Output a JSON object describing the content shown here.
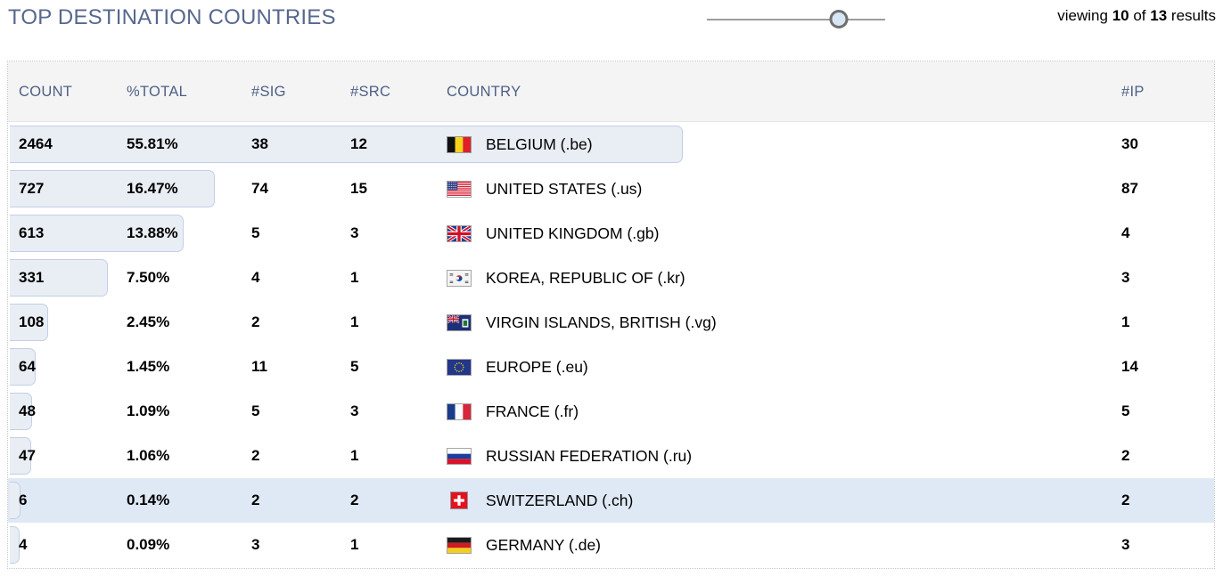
{
  "header": {
    "title": "TOP DESTINATION COUNTRIES",
    "slider": {
      "name": "results-count-slider",
      "position_pct": 74
    },
    "viewing": {
      "prefix": "viewing",
      "shown": "10",
      "middle": "of",
      "total": "13",
      "suffix": "results"
    }
  },
  "table": {
    "columns": [
      {
        "key": "count",
        "label": "COUNT"
      },
      {
        "key": "total",
        "label": "%TOTAL"
      },
      {
        "key": "sig",
        "label": "#SIG"
      },
      {
        "key": "src",
        "label": "#SRC"
      },
      {
        "key": "country",
        "label": "COUNTRY"
      },
      {
        "key": "ip",
        "label": "#IP"
      }
    ],
    "rows": [
      {
        "count": "2464",
        "total": "55.81%",
        "sig": "38",
        "src": "12",
        "country": "BELGIUM (.be)",
        "ip": "30",
        "flag": "flag-be",
        "bar_pct": 55.81,
        "highlight": false
      },
      {
        "count": "727",
        "total": "16.47%",
        "sig": "74",
        "src": "15",
        "country": "UNITED STATES (.us)",
        "ip": "87",
        "flag": "flag-us",
        "bar_pct": 16.47,
        "highlight": false
      },
      {
        "count": "613",
        "total": "13.88%",
        "sig": "5",
        "src": "3",
        "country": "UNITED KINGDOM (.gb)",
        "ip": "4",
        "flag": "flag-gb",
        "bar_pct": 13.88,
        "highlight": false
      },
      {
        "count": "331",
        "total": "7.50%",
        "sig": "4",
        "src": "1",
        "country": "KOREA, REPUBLIC OF (.kr)",
        "ip": "3",
        "flag": "flag-kr",
        "bar_pct": 7.5,
        "highlight": false
      },
      {
        "count": "108",
        "total": "2.45%",
        "sig": "2",
        "src": "1",
        "country": "VIRGIN ISLANDS, BRITISH (.vg)",
        "ip": "1",
        "flag": "flag-vg",
        "bar_pct": 2.45,
        "highlight": false
      },
      {
        "count": "64",
        "total": "1.45%",
        "sig": "11",
        "src": "5",
        "country": "EUROPE (.eu)",
        "ip": "14",
        "flag": "flag-eu",
        "bar_pct": 1.45,
        "highlight": false
      },
      {
        "count": "48",
        "total": "1.09%",
        "sig": "5",
        "src": "3",
        "country": "FRANCE (.fr)",
        "ip": "5",
        "flag": "flag-fr",
        "bar_pct": 1.09,
        "highlight": false
      },
      {
        "count": "47",
        "total": "1.06%",
        "sig": "2",
        "src": "1",
        "country": "RUSSIAN FEDERATION (.ru)",
        "ip": "2",
        "flag": "flag-ru",
        "bar_pct": 1.06,
        "highlight": false
      },
      {
        "count": "6",
        "total": "0.14%",
        "sig": "2",
        "src": "2",
        "country": "SWITZERLAND (.ch)",
        "ip": "2",
        "flag": "flag-ch",
        "bar_pct": 0.14,
        "highlight": true
      },
      {
        "count": "4",
        "total": "0.09%",
        "sig": "3",
        "src": "1",
        "country": "GERMANY (.de)",
        "ip": "3",
        "flag": "flag-de",
        "bar_pct": 0.09,
        "highlight": false
      }
    ]
  },
  "colors": {
    "title": "#57688e",
    "header_text": "#4e5f86",
    "header_bg": "#f4f4f4",
    "bar_fill": "#e9eef4",
    "bar_border": "#c3cfe8",
    "row_highlight": "#dfe9f5"
  }
}
